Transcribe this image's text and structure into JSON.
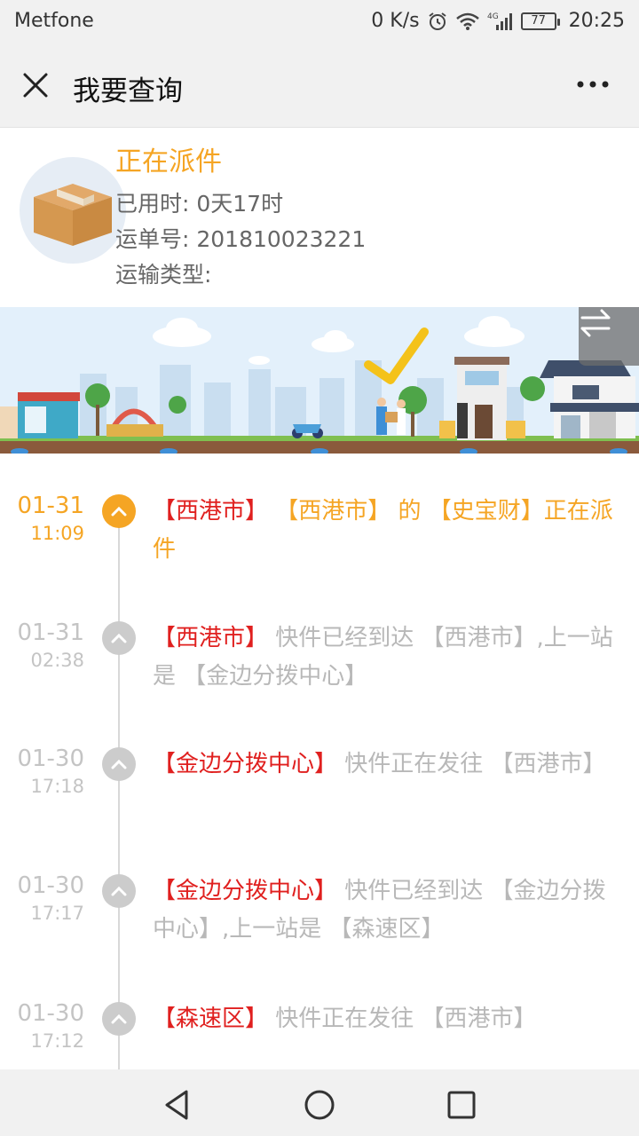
{
  "status_bar": {
    "carrier": "Metfone",
    "speed": "0 K/s",
    "battery": "77",
    "time": "20:25",
    "icons": [
      "alarm-icon",
      "wifi-icon",
      "signal-4g-icon",
      "battery-icon"
    ]
  },
  "nav": {
    "title": "我要查询",
    "close_icon": "close-icon",
    "more_icon": "more-icon"
  },
  "package": {
    "status": "正在派件",
    "elapsed": "已用时: 0天17时",
    "waybill": "运单号: 201810023221",
    "transport_type": "运输类型:"
  },
  "colors": {
    "accent_orange": "#f5a524",
    "location_red": "#e0201f",
    "muted_gray": "#b8b8b8"
  },
  "timeline": [
    {
      "date": "01-31",
      "time": "11:09",
      "location": "【西港市】",
      "text": " 【西港市】 的 【史宝财】正在派件",
      "active": true
    },
    {
      "date": "01-31",
      "time": "02:38",
      "location": "【西港市】",
      "text": " 快件已经到达 【西港市】,上一站是 【金边分拨中心】",
      "active": false
    },
    {
      "date": "01-30",
      "time": "17:18",
      "location": "【金边分拨中心】",
      "text": " 快件正在发往 【西港市】",
      "active": false
    },
    {
      "date": "01-30",
      "time": "17:17",
      "location": "【金边分拨中心】",
      "text": " 快件已经到达 【金边分拨中心】,上一站是 【森速区】",
      "active": false
    },
    {
      "date": "01-30",
      "time": "17:12",
      "location": "【森速区】",
      "text": " 快件正在发往 【西港市】",
      "active": false
    }
  ]
}
